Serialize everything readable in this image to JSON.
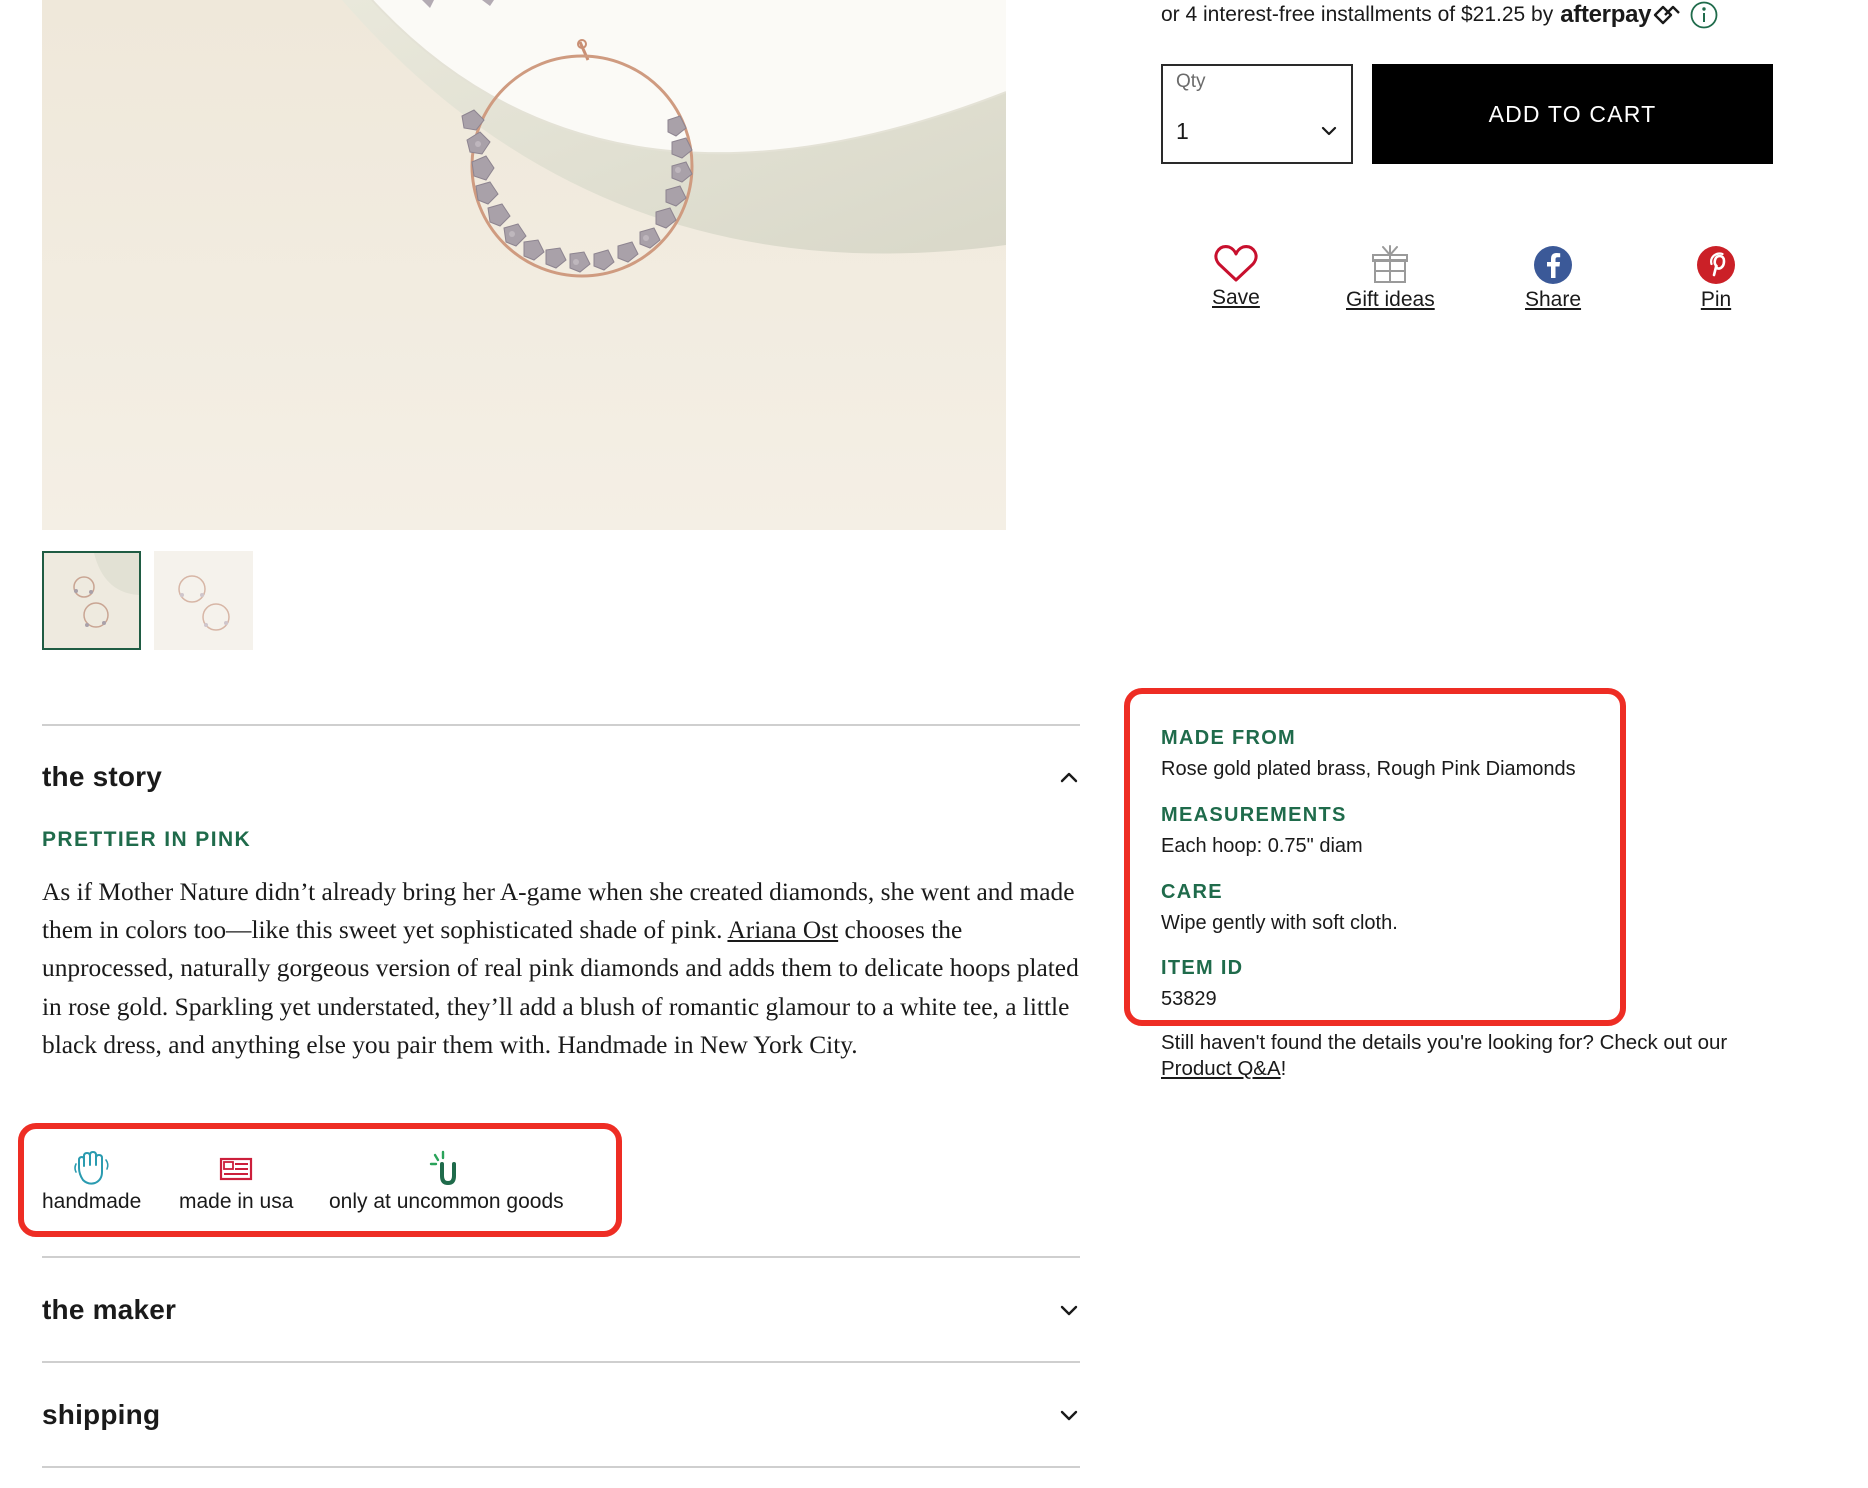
{
  "product": {
    "images": [
      {
        "name": "hoop-earring-on-pedestal"
      },
      {
        "name": "pair-of-hoop-earrings"
      }
    ]
  },
  "purchase": {
    "afterpay_text": "or 4 interest-free installments of $21.25 by",
    "afterpay_brand": "afterpay",
    "qty_label": "Qty",
    "qty_value": "1",
    "add_to_cart": "ADD TO CART"
  },
  "actions": {
    "save": "Save",
    "gift_ideas": "Gift ideas",
    "share": "Share",
    "pin": "Pin"
  },
  "accordion": {
    "story_title": "the story",
    "story_subtitle": "PRETTIER IN PINK",
    "story_text_before": "As if Mother Nature didn’t already bring her A-game when she created diamonds, she went and made them in colors too—like this sweet yet sophisticated shade of pink. ",
    "story_link": "Ariana Ost",
    "story_text_after": " chooses the unprocessed, naturally gorgeous version of real pink diamonds and adds them to delicate hoops plated in rose gold. Sparkling yet understated, they’ll add a blush of romantic glamour to a white tee, a little black dress, and anything else you pair them with. Handmade in New York City.",
    "maker_title": "the maker",
    "shipping_title": "shipping"
  },
  "badges": {
    "handmade": "handmade",
    "made_in_usa": "made in usa",
    "exclusive": "only at uncommon goods"
  },
  "details": {
    "made_from_label": "MADE FROM",
    "made_from_value": "Rose gold plated brass, Rough Pink Diamonds",
    "measurements_label": "MEASUREMENTS",
    "measurements_value": "Each hoop: 0.75\" diam",
    "care_label": "CARE",
    "care_value": "Wipe gently with soft cloth.",
    "item_id_label": "ITEM ID",
    "item_id_value": "53829"
  },
  "help": {
    "text": "Still haven't found the details you're looking for? Check out our ",
    "link": "Product Q&A",
    "suffix": "!"
  },
  "colors": {
    "accent_green": "#1f6b4b",
    "highlight_red": "#ee2d24",
    "cart_black": "#000000",
    "handmade_teal": "#2a9bb0",
    "usa_red": "#cc1f3b",
    "facebook_blue": "#3b5998",
    "pinterest_red": "#cb2027",
    "heart_red": "#c8102e"
  },
  "icons": {
    "info": "info-circle-icon",
    "caret": "chevron-down-icon",
    "save": "heart-outline-icon",
    "gift": "gift-box-icon",
    "share": "facebook-icon",
    "pin": "pinterest-icon",
    "handmade": "hand-icon",
    "usa": "flag-icon",
    "exclusive": "uncommon-goods-u-icon"
  }
}
